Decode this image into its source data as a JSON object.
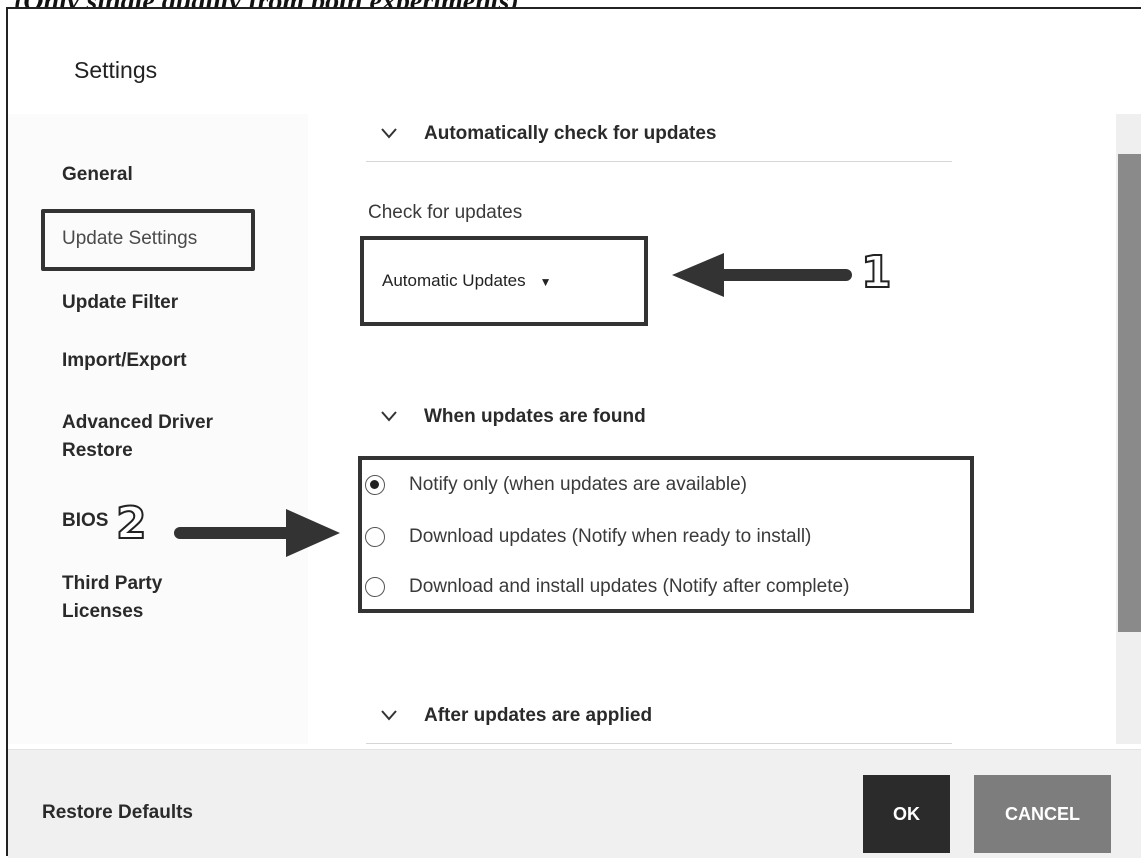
{
  "caption": "(Only single quality from both experiments)",
  "window": {
    "title": "Settings"
  },
  "sidebar": {
    "items": [
      {
        "label": "General",
        "active": false
      },
      {
        "label": "Update Settings",
        "active": true
      },
      {
        "label": "Update Filter",
        "active": false
      },
      {
        "label": "Import/Export",
        "active": false
      },
      {
        "label": "Advanced Driver Restore",
        "active": false
      },
      {
        "label": "BIOS",
        "active": false
      },
      {
        "label": "Third Party Licenses",
        "active": false
      }
    ]
  },
  "main": {
    "sections": [
      {
        "heading": "Automatically check for updates",
        "expanded": true
      },
      {
        "heading": "When updates are found",
        "expanded": true
      },
      {
        "heading": "After updates are applied",
        "expanded": true
      }
    ],
    "check_for_updates": {
      "label": "Check for updates",
      "selected": "Automatic Updates"
    },
    "when_found_options": [
      {
        "label": "Notify only (when updates are available)",
        "checked": true
      },
      {
        "label": "Download updates (Notify when ready to install)",
        "checked": false
      },
      {
        "label": "Download and install updates (Notify after complete)",
        "checked": false
      }
    ]
  },
  "annotations": {
    "callout_1": "1",
    "callout_2": "2"
  },
  "footer": {
    "restore_label": "Restore Defaults",
    "ok_label": "OK",
    "cancel_label": "CANCEL"
  },
  "colors": {
    "ok_button": "#2b2b2b",
    "cancel_button": "#7d7d7d",
    "scrollbar_thumb": "#8a8a8a"
  }
}
